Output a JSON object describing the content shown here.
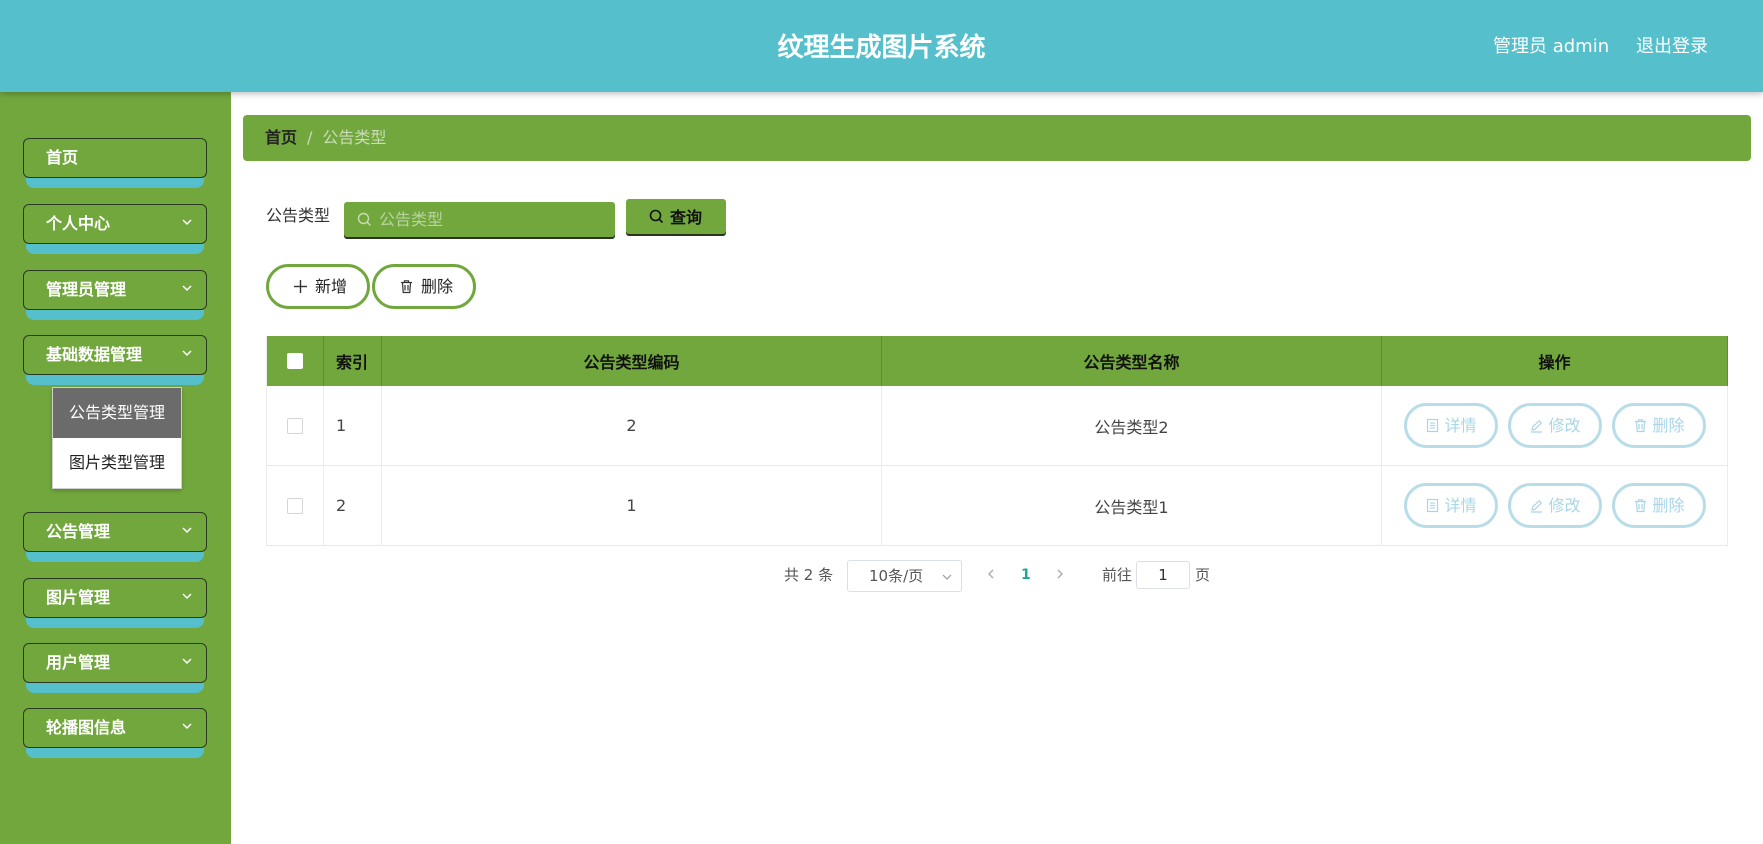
{
  "header": {
    "title": "纹理生成图片系统",
    "admin": "管理员 admin",
    "logout": "退出登录"
  },
  "sidebar": {
    "items": [
      {
        "label": "首页",
        "has_chevron": false
      },
      {
        "label": "个人中心",
        "has_chevron": true
      },
      {
        "label": "管理员管理",
        "has_chevron": true
      },
      {
        "label": "基础数据管理",
        "has_chevron": true,
        "expanded": true
      },
      {
        "label": "公告管理",
        "has_chevron": true
      },
      {
        "label": "图片管理",
        "has_chevron": true
      },
      {
        "label": "用户管理",
        "has_chevron": true
      },
      {
        "label": "轮播图信息",
        "has_chevron": true
      }
    ],
    "submenu": [
      {
        "label": "公告类型管理",
        "active": true
      },
      {
        "label": "图片类型管理",
        "active": false
      }
    ]
  },
  "breadcrumb": {
    "home": "首页",
    "separator": "/",
    "current": "公告类型"
  },
  "search": {
    "label": "公告类型",
    "placeholder": "公告类型",
    "button": "查询"
  },
  "actions": {
    "add": "新增",
    "delete": "删除"
  },
  "table": {
    "headers": {
      "index": "索引",
      "code": "公告类型编码",
      "name": "公告类型名称",
      "ops": "操作"
    },
    "rows": [
      {
        "index": "1",
        "code": "2",
        "name": "公告类型2"
      },
      {
        "index": "2",
        "code": "1",
        "name": "公告类型1"
      }
    ],
    "row_ops": {
      "detail": "详情",
      "edit": "修改",
      "delete": "删除"
    }
  },
  "pagination": {
    "total": "共 2 条",
    "page_size": "10条/页",
    "current_page": "1",
    "goto_label": "前往",
    "goto_value": "1",
    "page_suffix": "页"
  },
  "colors": {
    "header_bg": "#55c0cc",
    "sidebar_bg": "#72a73e",
    "accent_green": "#72a73e",
    "op_button_border": "#b9dde8",
    "active_page": "#1aa89b"
  }
}
